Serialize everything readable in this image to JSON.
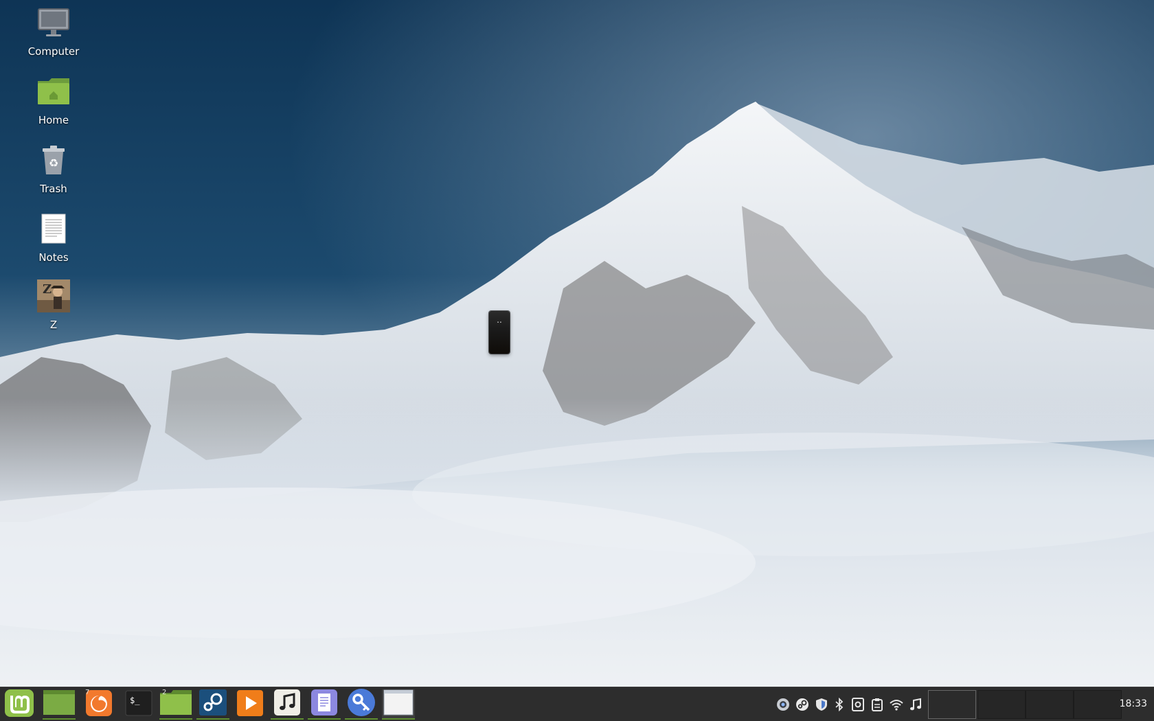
{
  "desktop": {
    "icons": [
      {
        "label": "Computer",
        "icon": "computer-icon"
      },
      {
        "label": "Home",
        "icon": "home-folder-icon"
      },
      {
        "label": "Trash",
        "icon": "trash-icon"
      },
      {
        "label": "Notes",
        "icon": "text-document-icon"
      },
      {
        "label": "Z",
        "icon": "game-image-icon"
      }
    ],
    "widget_text": ".."
  },
  "panel": {
    "launchers": [
      {
        "name": "menu",
        "icon": "mint-menu-icon"
      },
      {
        "name": "files",
        "icon": "folder-icon"
      },
      {
        "name": "firefox",
        "icon": "firefox-icon",
        "badge": "7"
      },
      {
        "name": "terminal",
        "icon": "terminal-icon",
        "text": "$_"
      },
      {
        "name": "files-2",
        "icon": "folder-icon",
        "badge": "2"
      },
      {
        "name": "steam",
        "icon": "steam-icon"
      },
      {
        "name": "media-player",
        "icon": "play-icon"
      },
      {
        "name": "music",
        "icon": "music-note-icon"
      },
      {
        "name": "text-editor",
        "icon": "document-icon"
      },
      {
        "name": "passwords",
        "icon": "key-icon"
      },
      {
        "name": "window",
        "icon": "window-icon"
      }
    ],
    "tray": [
      "update-manager-icon",
      "steam-tray-icon",
      "shield-icon",
      "bluetooth-icon",
      "notes-tray-icon",
      "clipboard-icon",
      "wifi-icon",
      "music-tray-icon"
    ],
    "workspaces": 4,
    "clock": "18:33"
  },
  "colors": {
    "panel_bg": "#2d2d2d",
    "mint_green": "#8fc04a",
    "folder_green": "#7bab44"
  }
}
